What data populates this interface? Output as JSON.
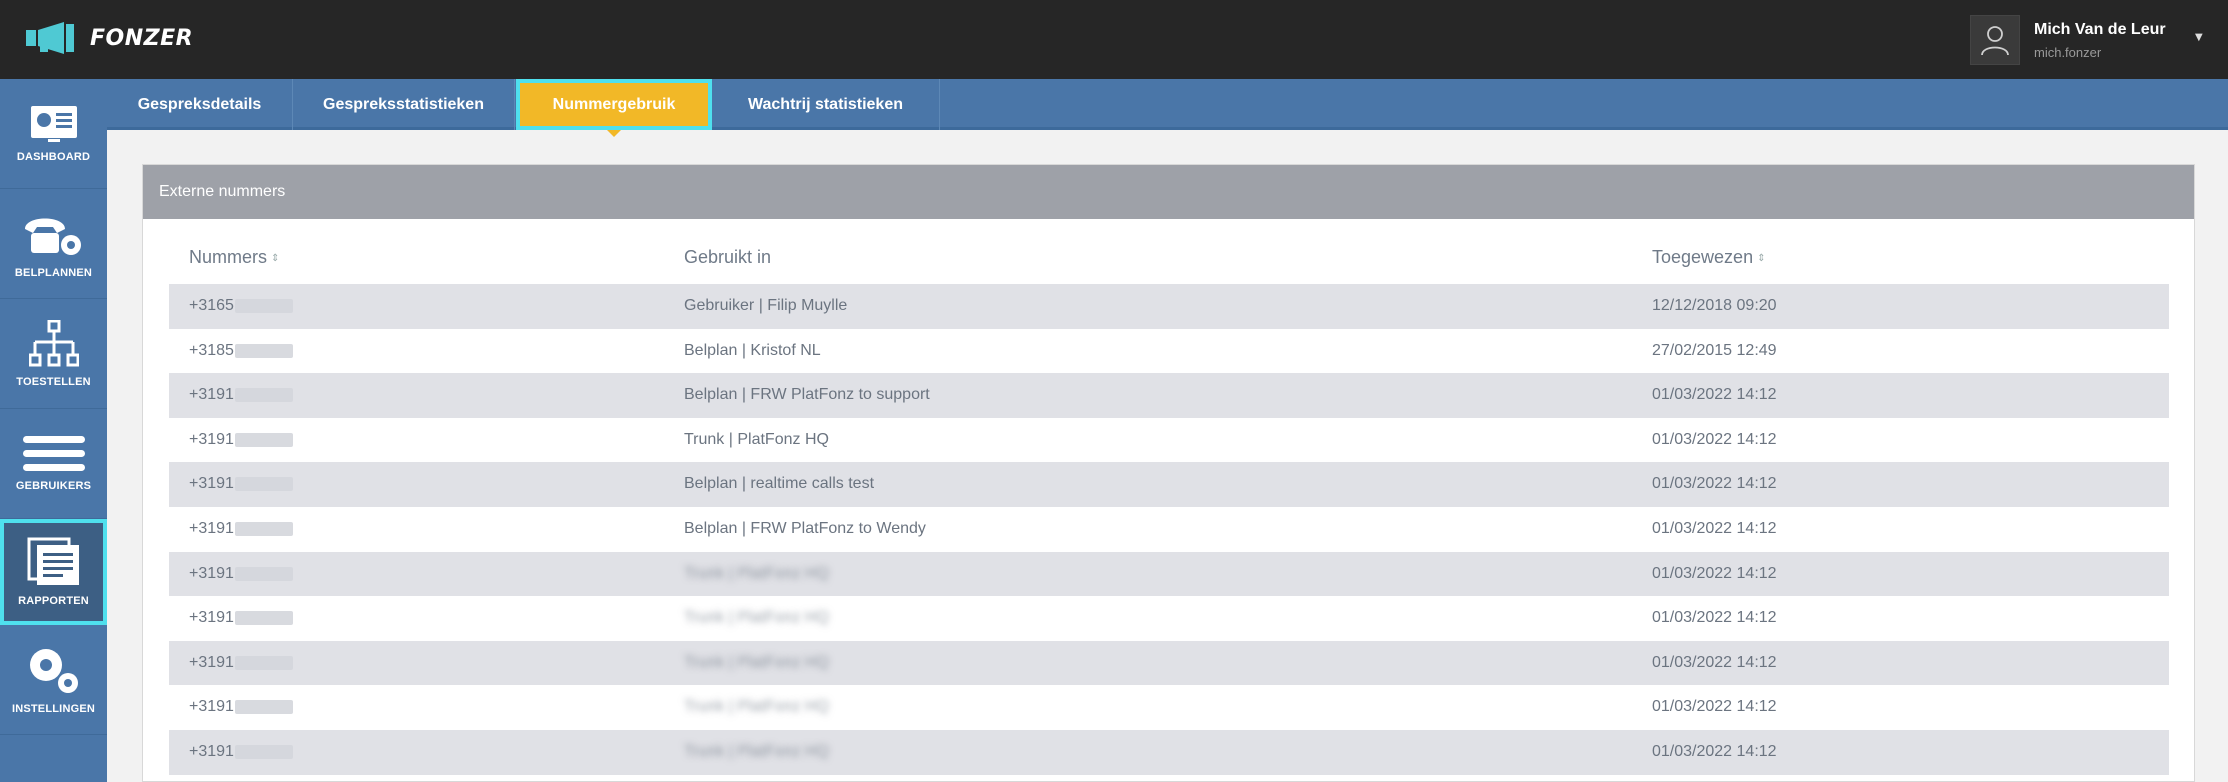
{
  "app": {
    "logo_text": "FONZER"
  },
  "user": {
    "name": "Mich Van de Leur",
    "username": "mich.fonzer"
  },
  "sidebar": {
    "items": [
      {
        "label": "DASHBOARD",
        "icon": "dashboard-icon"
      },
      {
        "label": "BELPLANNEN",
        "icon": "phone-gear-icon"
      },
      {
        "label": "TOESTELLEN",
        "icon": "hierarchy-icon"
      },
      {
        "label": "GEBRUIKERS",
        "icon": "menu-icon"
      },
      {
        "label": "RAPPORTEN",
        "icon": "report-icon",
        "active": true
      },
      {
        "label": "INSTELLINGEN",
        "icon": "gears-icon"
      }
    ]
  },
  "tabs": [
    {
      "label": "Gespreksdetails"
    },
    {
      "label": "Gespreksstatistieken"
    },
    {
      "label": "Nummergebruik",
      "active": true
    },
    {
      "label": "Wachtrij statistieken"
    }
  ],
  "panel": {
    "title": "Externe nummers",
    "columns": [
      "Nummers",
      "Gebruikt in",
      "Toegewezen"
    ],
    "rows": [
      {
        "number": "+3165",
        "used_in": "Gebruiker | Filip Muylle",
        "assigned": "12/12/2018 09:20"
      },
      {
        "number": "+3185",
        "used_in": "Belplan | Kristof NL",
        "assigned": "27/02/2015 12:49"
      },
      {
        "number": "+3191",
        "used_in": "Belplan | FRW PlatFonz to support",
        "assigned": "01/03/2022 14:12"
      },
      {
        "number": "+3191",
        "used_in": "Trunk | PlatFonz HQ",
        "assigned": "01/03/2022 14:12"
      },
      {
        "number": "+3191",
        "used_in": "Belplan | realtime calls test",
        "assigned": "01/03/2022 14:12"
      },
      {
        "number": "+3191",
        "used_in": "Belplan | FRW PlatFonz to Wendy",
        "assigned": "01/03/2022 14:12"
      },
      {
        "number": "+3191",
        "used_in": "Trunk | PlatFonz HQ",
        "assigned": "01/03/2022 14:12",
        "blurred": true
      },
      {
        "number": "+3191",
        "used_in": "Trunk | PlatFonz HQ",
        "assigned": "01/03/2022 14:12",
        "blurred": true
      },
      {
        "number": "+3191",
        "used_in": "Trunk | PlatFonz HQ",
        "assigned": "01/03/2022 14:12",
        "blurred": true
      },
      {
        "number": "+3191",
        "used_in": "Trunk | PlatFonz HQ",
        "assigned": "01/03/2022 14:12",
        "blurred": true
      },
      {
        "number": "+3191",
        "used_in": "Trunk | PlatFonz HQ",
        "assigned": "01/03/2022 14:12",
        "blurred": true
      }
    ]
  },
  "colors": {
    "topbar": "#262626",
    "sidebar": "#4a76a8",
    "accent": "#f2b827",
    "highlight": "#4fe0ee"
  }
}
